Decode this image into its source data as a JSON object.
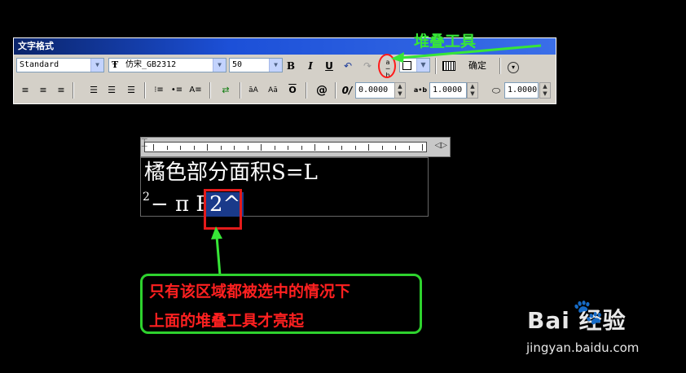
{
  "window": {
    "title": "文字格式"
  },
  "toolbar": {
    "style_value": "Standard",
    "font_value": "仿宋_GB2312",
    "height_value": "50",
    "bold_label": "B",
    "italic_label": "I",
    "underline_label": "U",
    "ok_label": "确定",
    "oblique_value": "0.0000",
    "tracking_value": "1.0000",
    "width_value": "1.0000"
  },
  "editor": {
    "line1": "橘色部分面积S=L",
    "line2_sup": "2",
    "line2_prefix": "− π R",
    "line2_selected": "2^"
  },
  "annotations": {
    "stack_tool_label": "堆叠工具",
    "callout_line1": "只有该区域都被选中的情况下",
    "callout_line2": "上面的堆叠工具才亮起",
    "annotation_color": "#37e637",
    "highlight_color": "#ff2020"
  },
  "watermark": {
    "brand": "Bai 经验",
    "url": "jingyan.baidu.com"
  }
}
